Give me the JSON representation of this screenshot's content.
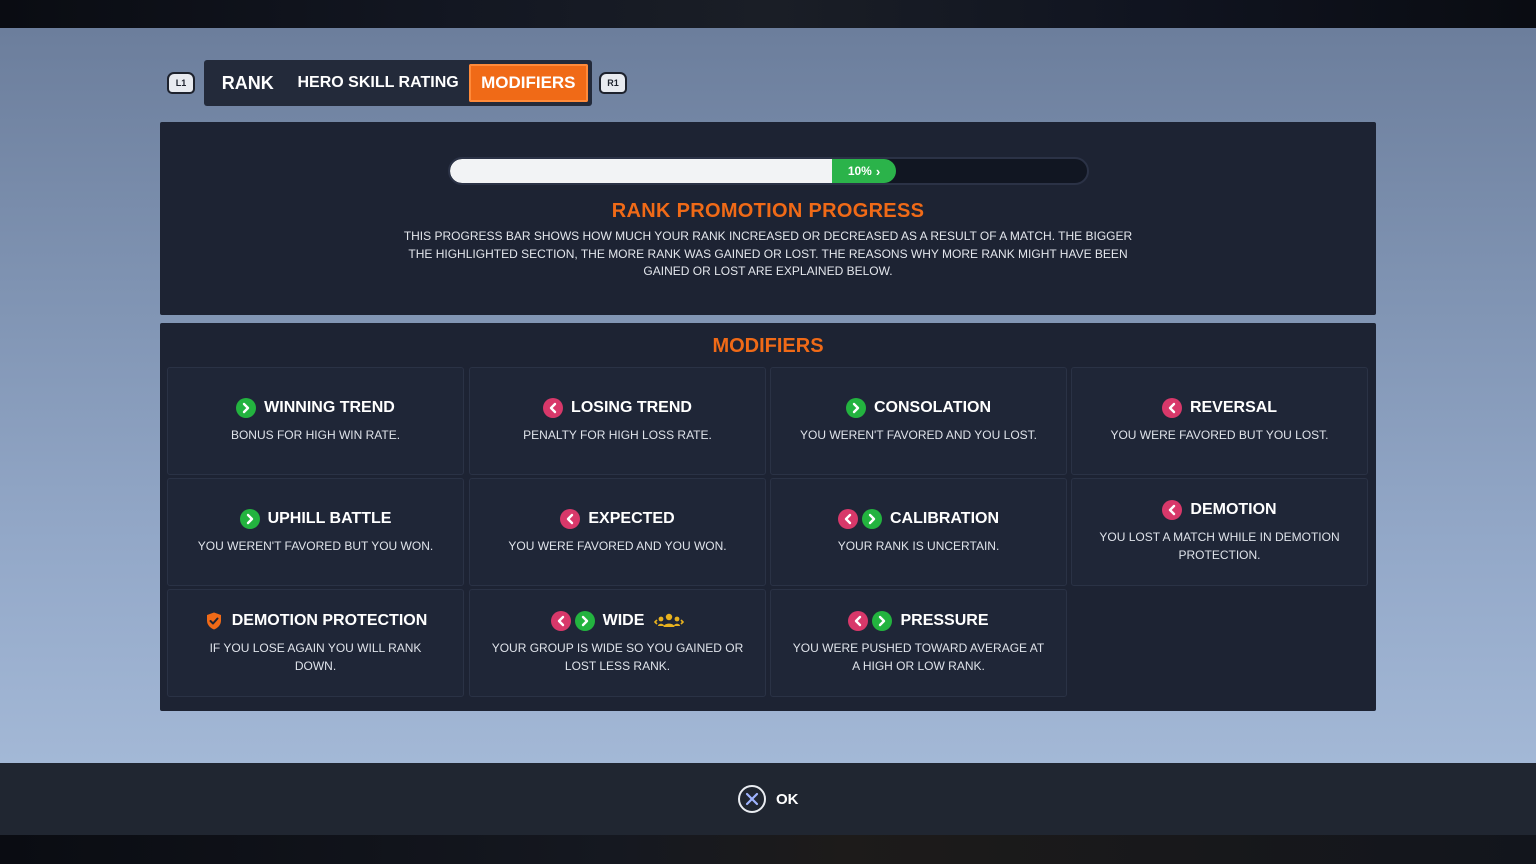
{
  "tabs": {
    "left_bumper": "L1",
    "right_bumper": "R1",
    "items": [
      {
        "label": "RANK"
      },
      {
        "label": "HERO SKILL RATING"
      },
      {
        "label": "MODIFIERS",
        "active": true
      }
    ]
  },
  "progress": {
    "percent": 10,
    "percent_label": "10%",
    "base_fill_fraction": 0.6,
    "title": "RANK PROMOTION PROGRESS",
    "description": "THIS PROGRESS BAR SHOWS HOW MUCH YOUR RANK INCREASED OR DECREASED AS A RESULT OF A MATCH. THE BIGGER THE HIGHLIGHTED SECTION, THE MORE RANK WAS GAINED OR LOST. THE REASONS WHY MORE RANK MIGHT HAVE BEEN GAINED OR LOST ARE EXPLAINED BELOW."
  },
  "modifiers": {
    "title": "MODIFIERS",
    "cards": [
      {
        "title": "WINNING TREND",
        "desc": "BONUS FOR HIGH WIN RATE.",
        "icons": [
          "up-chevron-icon"
        ]
      },
      {
        "title": "LOSING TREND",
        "desc": "PENALTY FOR HIGH LOSS RATE.",
        "icons": [
          "down-chevron-icon"
        ]
      },
      {
        "title": "CONSOLATION",
        "desc": "YOU WEREN'T FAVORED AND YOU LOST.",
        "icons": [
          "up-chevron-icon"
        ]
      },
      {
        "title": "REVERSAL",
        "desc": "YOU WERE FAVORED BUT YOU LOST.",
        "icons": [
          "down-chevron-icon"
        ]
      },
      {
        "title": "UPHILL BATTLE",
        "desc": "YOU WEREN'T FAVORED BUT YOU WON.",
        "icons": [
          "up-chevron-icon"
        ]
      },
      {
        "title": "EXPECTED",
        "desc": "YOU WERE FAVORED AND YOU WON.",
        "icons": [
          "down-chevron-icon"
        ]
      },
      {
        "title": "CALIBRATION",
        "desc": "YOUR RANK IS UNCERTAIN.",
        "icons": [
          "down-chevron-icon",
          "up-chevron-icon"
        ]
      },
      {
        "title": "DEMOTION",
        "desc": "YOU LOST A MATCH WHILE IN DEMOTION PROTECTION.",
        "icons": [
          "down-chevron-icon"
        ]
      },
      {
        "title": "DEMOTION PROTECTION",
        "desc": "IF YOU LOSE AGAIN YOU WILL RANK DOWN.",
        "icons": [
          "shield-icon"
        ]
      },
      {
        "title": "WIDE",
        "desc": "YOUR GROUP IS WIDE SO YOU GAINED OR LOST LESS RANK.",
        "icons": [
          "down-chevron-icon",
          "up-chevron-icon"
        ],
        "suffix_icon": "group-icon"
      },
      {
        "title": "PRESSURE",
        "desc": "YOU WERE PUSHED TOWARD AVERAGE AT A HIGH OR LOW RANK.",
        "icons": [
          "down-chevron-icon",
          "up-chevron-icon"
        ]
      }
    ]
  },
  "footer": {
    "ok_button_icon": "cross-button-icon",
    "ok_label": "OK"
  },
  "colors": {
    "accent_orange": "#f06a17",
    "up_green": "#23b33f",
    "down_pink": "#d8386a",
    "panel": "#1d2333"
  }
}
